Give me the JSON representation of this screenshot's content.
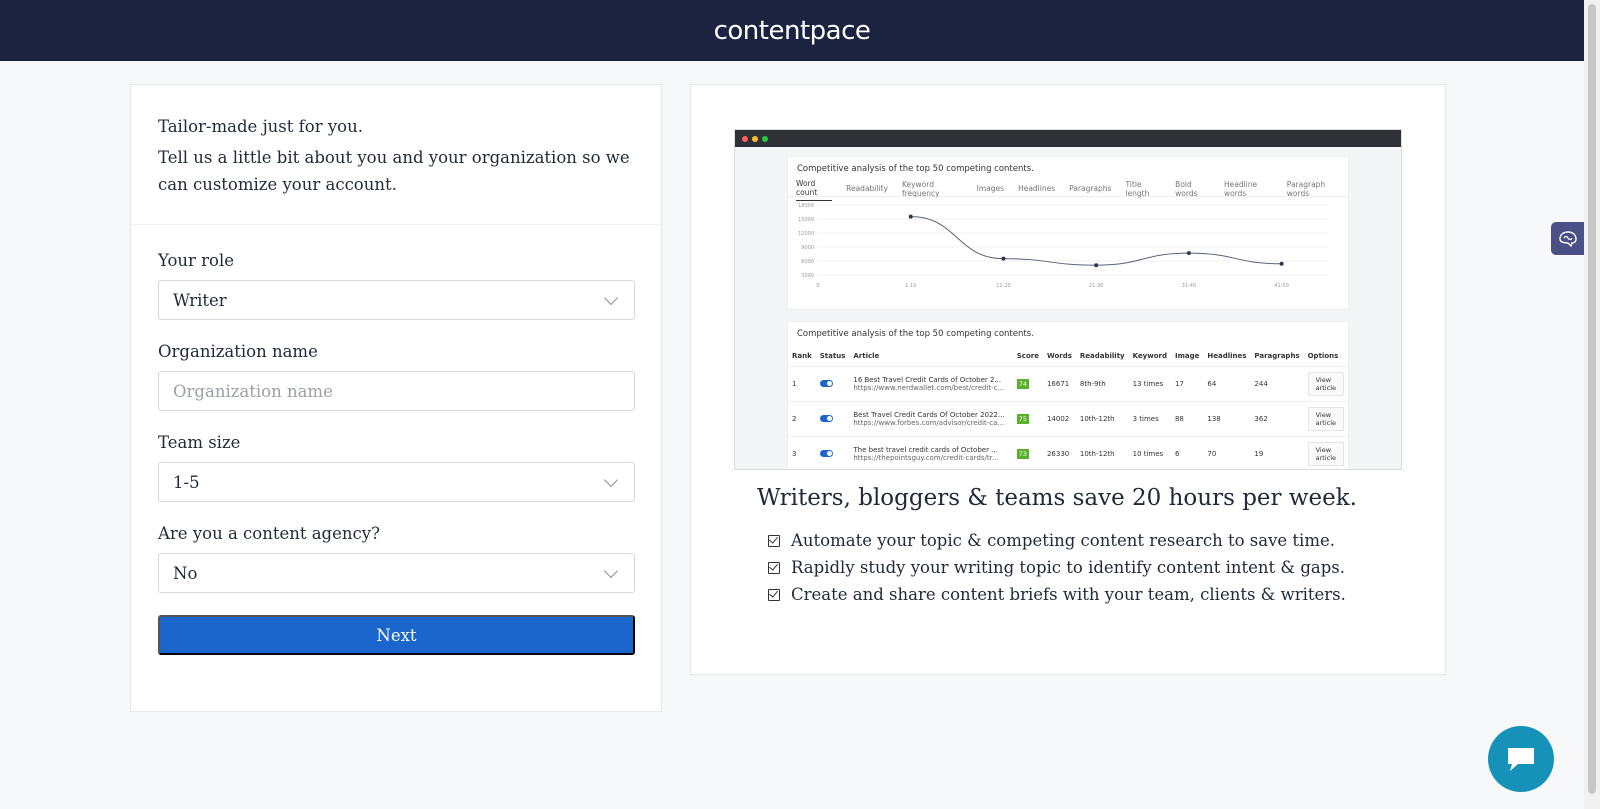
{
  "header": {
    "logo": "contentpace"
  },
  "form": {
    "tagline": "Tailor-made just for you.",
    "intro": "Tell us a little bit about you and your organization so we can customize your account.",
    "role_label": "Your role",
    "role_value": "Writer",
    "org_label": "Organization name",
    "org_placeholder": "Organization name",
    "team_label": "Team size",
    "team_value": "1-5",
    "agency_label": "Are you a content agency?",
    "agency_value": "No",
    "next_label": "Next"
  },
  "promo": {
    "headline": "Writers, bloggers & teams save 20 hours per week.",
    "benefits": [
      "Automate your topic & competing content research to save time.",
      "Rapidly study your writing topic to identify content intent & gaps.",
      "Create and share content briefs with your team, clients & writers."
    ]
  },
  "screenshot": {
    "chart_title": "Competitive analysis of the top 50 competing contents.",
    "tabs": [
      "Word count",
      "Readability",
      "Keyword frequency",
      "Images",
      "Headlines",
      "Paragraphs",
      "Title length",
      "Bold words",
      "Headline words",
      "Paragraph words"
    ],
    "chart_data": {
      "type": "line",
      "categories": [
        "1-10",
        "11-20",
        "21-30",
        "31-40",
        "41-50"
      ],
      "values": [
        15500,
        6500,
        5100,
        7700,
        5400
      ],
      "y_ticks": [
        "18000",
        "15000",
        "12000",
        "9000",
        "6000",
        "3000"
      ],
      "x_start_label": "0",
      "ylim": [
        3000,
        18000
      ]
    },
    "table_title": "Competitive analysis of the top 50 competing contents.",
    "table_headers": [
      "Rank",
      "Status",
      "Article",
      "Score",
      "Words",
      "Readability",
      "Keyword",
      "Image",
      "Headlines",
      "Paragraphs",
      "Options"
    ],
    "rows": [
      {
        "rank": "1",
        "title": "16 Best Travel Credit Cards of October 2...",
        "url": "https://www.nerdwallet.com/best/credit-c...",
        "score": "74",
        "words": "16671",
        "readability": "8th-9th",
        "keyword": "13 times",
        "image": "17",
        "headlines": "64",
        "paragraphs": "244",
        "option": "View article"
      },
      {
        "rank": "2",
        "title": "Best Travel Credit Cards Of October 2022...",
        "url": "https://www.forbes.com/advisor/credit-ca...",
        "score": "75",
        "words": "14002",
        "readability": "10th-12th",
        "keyword": "3 times",
        "image": "88",
        "headlines": "138",
        "paragraphs": "362",
        "option": "View article"
      },
      {
        "rank": "3",
        "title": "The best travel credit cards of October ...",
        "url": "https://thepointsguy.com/credit-cards/tr...",
        "score": "73",
        "words": "26330",
        "readability": "10th-12th",
        "keyword": "10 times",
        "image": "6",
        "headlines": "70",
        "paragraphs": "19",
        "option": "View article"
      }
    ]
  },
  "colors": {
    "header_bg": "#1b2341",
    "primary": "#1a66cc",
    "chat": "#1692b8",
    "side_widget": "#4a4f86"
  },
  "icons": {
    "chat": "chat-bubble-icon",
    "widget": "brain-icon",
    "chevron": "chevron-down-icon",
    "check": "checkbox-checked-icon"
  }
}
